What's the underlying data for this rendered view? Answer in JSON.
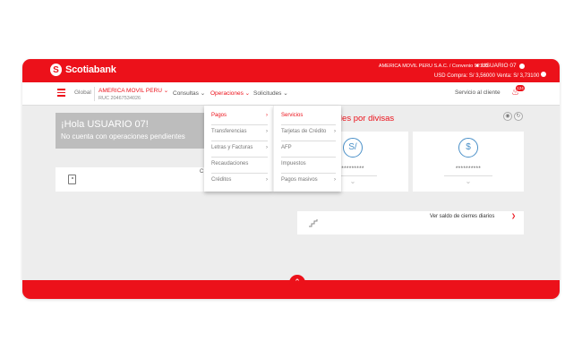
{
  "brand": {
    "name": "Scotiabank"
  },
  "topbar": {
    "company_info": "AMERICA MOVIL PERU S.A.C. / Convenio 92100",
    "user": "USUARIO 07",
    "fx_buy_label": "USD Compra:",
    "fx_buy_value": "S/ 3,56000",
    "fx_sell_label": "Venta:",
    "fx_sell_value": "S/ 3,73100"
  },
  "nav": {
    "global_label": "Global",
    "company_name": "AMERICA MOVIL PERU",
    "ruc": "RUC 20467534026",
    "menus": [
      "Consultas",
      "Operaciones",
      "Solicitudes"
    ],
    "active_menu": "Operaciones",
    "service_label": "Servicio al cliente",
    "notification_count": "124"
  },
  "greeting": {
    "title": "¡Hola USUARIO 07!",
    "subtitle": "No cuenta con operaciones pendientes"
  },
  "divisas": {
    "title": "tales por divisas",
    "cards": [
      {
        "symbol": "S/",
        "masked": "*********"
      },
      {
        "symbol": "$",
        "masked": "**********"
      }
    ]
  },
  "quick_panel": {
    "text": "C"
  },
  "cierres": {
    "link": "Ver saldo de cierres diarios"
  },
  "operaciones_menu": {
    "items": [
      {
        "label": "Pagos",
        "active": true
      },
      {
        "label": "Transferencias",
        "active": false
      },
      {
        "label": "Letras y Facturas",
        "active": false
      },
      {
        "label": "Recaudaciones",
        "active": false
      },
      {
        "label": "Créditos",
        "active": false
      }
    ]
  },
  "pagos_submenu": {
    "items": [
      {
        "label": "Servicios",
        "active": true
      },
      {
        "label": "Tarjetas de Crédito",
        "active": false
      },
      {
        "label": "AFP",
        "active": false
      },
      {
        "label": "Impuestos",
        "active": false
      },
      {
        "label": "Pagos masivos",
        "active": false
      }
    ]
  },
  "icons": {
    "menu": "hamburger-icon",
    "notification": "bell-icon",
    "scroll_top": "chevron-up-icon"
  },
  "colors": {
    "brand_red": "#ec111a",
    "currency_blue": "#4a90c8",
    "greeting_bg": "#bdbdbd"
  }
}
